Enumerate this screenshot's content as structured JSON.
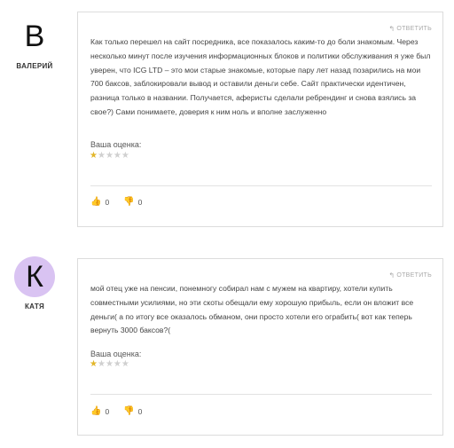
{
  "comments": [
    {
      "author_initial": "B",
      "author_name": "ВАЛЕРИЙ",
      "reply_label": "ОТВЕТИТЬ",
      "text": "Как только перешел на сайт посредника, все показалось каким-то до боли знакомым. Через несколько минут после изучения информационных блоков и политики обслуживания я уже был уверен, что ICG LTD – это мои старые знакомые, которые пару лет назад позарились на мои 700 баксов, заблокировали вывод и оставили деньги себе. Сайт практически идентичен, разница только в названии. Получается, аферисты сделали ребрендинг и снова взялись за свое?) Сами понимаете, доверия к ним ноль и вполне заслуженно",
      "rating_label": "Ваша оценка:",
      "rating": 1,
      "rating_max": 5,
      "likes": "0",
      "dislikes": "0"
    },
    {
      "author_initial": "К",
      "author_name": "КАТЯ",
      "reply_label": "ОТВЕТИТЬ",
      "text": "мой отец уже на пенсии, понемногу собирал нам с мужем на квартиру, хотели купить совместными усилиями, но эти скоты обещали ему хорошую прибыль, если он вложит все деньги( а по итогу все оказалось обманом, они просто хотели его ограбить( вот как теперь вернуть 3000 баксов?(",
      "rating_label": "Ваша оценка:",
      "rating": 1,
      "rating_max": 5,
      "likes": "0",
      "dislikes": "0"
    }
  ],
  "colors": {
    "star_on": "#e2b62a",
    "star_off": "#d0d0d0",
    "like": "#3b9a3b",
    "dislike": "#d9534f",
    "avatar_katya": "#d9c3f2"
  },
  "icons": {
    "reply": "reply-arrow-icon",
    "star": "star-icon",
    "like": "thumbs-up-icon",
    "dislike": "thumbs-down-icon"
  }
}
